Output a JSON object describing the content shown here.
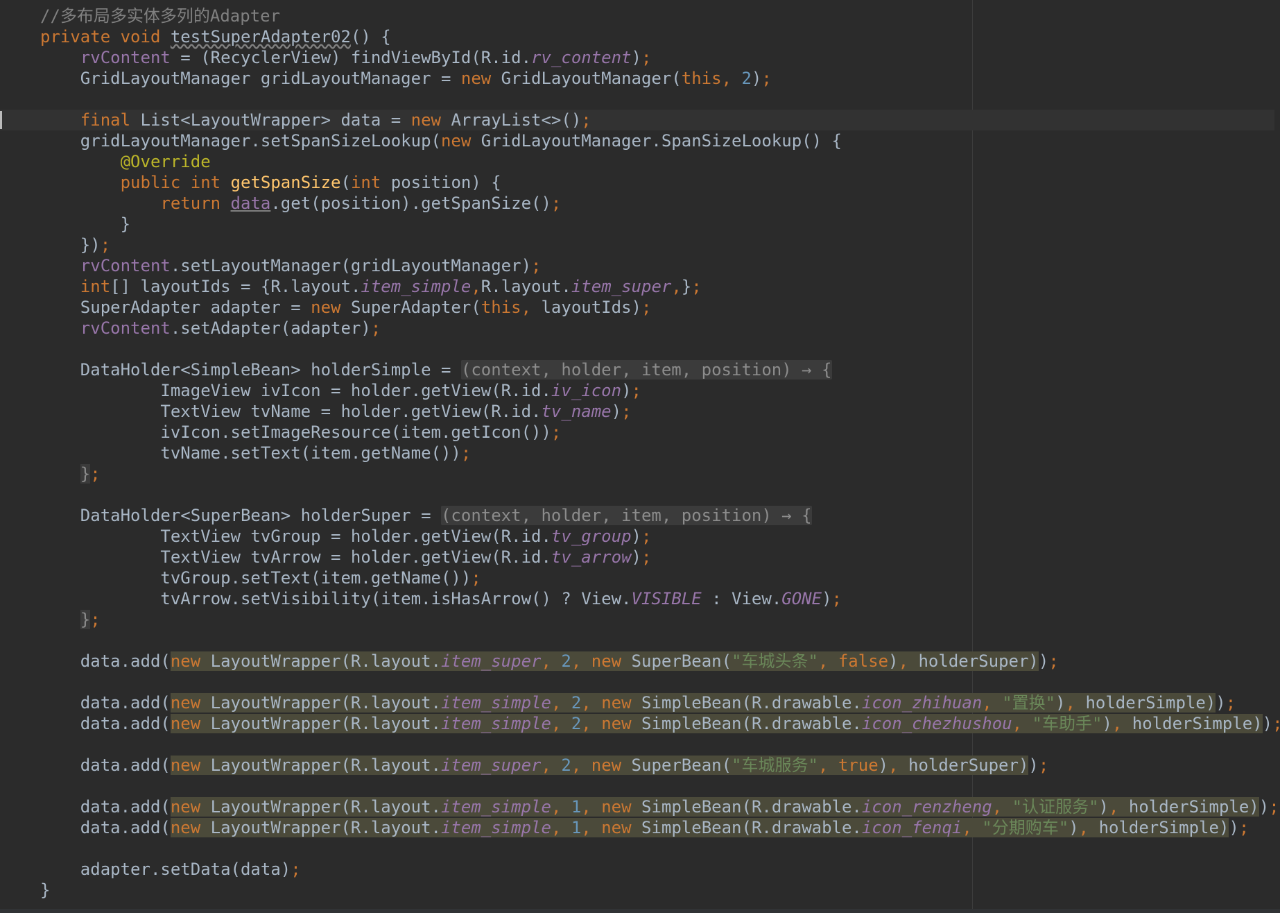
{
  "editor": {
    "language": "java",
    "colors": {
      "background": "#2b2b2b",
      "default": "#a9b7c6",
      "keyword": "#cc7832",
      "comment": "#808080",
      "field": "#9876aa",
      "number": "#6897bb",
      "string": "#6a8759",
      "annotation": "#bbb529",
      "method_decl": "#ffc66d"
    },
    "current_line_index": 5,
    "lines": [
      [
        {
          "t": "//多布局多实体多列的Adapter",
          "c": "cm"
        }
      ],
      [
        {
          "t": "private void ",
          "c": "kw"
        },
        {
          "t": "testSuperAdapter02",
          "c": "wavy"
        },
        {
          "t": "() {",
          "c": ""
        }
      ],
      [
        {
          "t": "    ",
          "c": ""
        },
        {
          "t": "rvContent",
          "c": "fld"
        },
        {
          "t": " = (RecyclerView) findViewById(R.id.",
          "c": ""
        },
        {
          "t": "rv_content",
          "c": "ifld"
        },
        {
          "t": ")",
          "c": ""
        },
        {
          "t": ";",
          "c": "kw"
        }
      ],
      [
        {
          "t": "    GridLayoutManager gridLayoutManager = ",
          "c": ""
        },
        {
          "t": "new ",
          "c": "kw"
        },
        {
          "t": "GridLayoutManager(",
          "c": ""
        },
        {
          "t": "this",
          "c": "kw"
        },
        {
          "t": ", ",
          "c": "kw"
        },
        {
          "t": "2",
          "c": "num"
        },
        {
          "t": ")",
          "c": ""
        },
        {
          "t": ";",
          "c": "kw"
        }
      ],
      [],
      [
        {
          "t": "    ",
          "c": ""
        },
        {
          "t": "final ",
          "c": "kw"
        },
        {
          "t": "List<LayoutWrapper> data = ",
          "c": ""
        },
        {
          "t": "new ",
          "c": "kw"
        },
        {
          "t": "ArrayList<>()",
          "c": ""
        },
        {
          "t": ";",
          "c": "kw"
        }
      ],
      [
        {
          "t": "    gridLayoutManager.setSpanSizeLookup(",
          "c": ""
        },
        {
          "t": "new ",
          "c": "kw"
        },
        {
          "t": "GridLayoutManager.SpanSizeLookup() {",
          "c": ""
        }
      ],
      [
        {
          "t": "        ",
          "c": ""
        },
        {
          "t": "@Override",
          "c": "ann"
        }
      ],
      [
        {
          "t": "        ",
          "c": ""
        },
        {
          "t": "public int ",
          "c": "kw"
        },
        {
          "t": "getSpanSize",
          "c": "mth"
        },
        {
          "t": "(",
          "c": ""
        },
        {
          "t": "int ",
          "c": "kw"
        },
        {
          "t": "position) {",
          "c": ""
        }
      ],
      [
        {
          "t": "            ",
          "c": ""
        },
        {
          "t": "return ",
          "c": "kw"
        },
        {
          "t": "data",
          "c": "fld ul"
        },
        {
          "t": ".get(position).getSpanSize()",
          "c": ""
        },
        {
          "t": ";",
          "c": "kw"
        }
      ],
      [
        {
          "t": "        }",
          "c": ""
        }
      ],
      [
        {
          "t": "    })",
          "c": ""
        },
        {
          "t": ";",
          "c": "kw"
        }
      ],
      [
        {
          "t": "    ",
          "c": ""
        },
        {
          "t": "rvContent",
          "c": "fld"
        },
        {
          "t": ".setLayoutManager(gridLayoutManager)",
          "c": ""
        },
        {
          "t": ";",
          "c": "kw"
        }
      ],
      [
        {
          "t": "    ",
          "c": ""
        },
        {
          "t": "int",
          "c": "kw"
        },
        {
          "t": "[] layoutIds = {R.layout.",
          "c": ""
        },
        {
          "t": "item_simple",
          "c": "ifld"
        },
        {
          "t": ",",
          "c": "kw"
        },
        {
          "t": "R.layout.",
          "c": ""
        },
        {
          "t": "item_super",
          "c": "ifld"
        },
        {
          "t": ",",
          "c": "kw"
        },
        {
          "t": "}",
          "c": ""
        },
        {
          "t": ";",
          "c": "kw"
        }
      ],
      [
        {
          "t": "    SuperAdapter adapter = ",
          "c": ""
        },
        {
          "t": "new ",
          "c": "kw"
        },
        {
          "t": "SuperAdapter(",
          "c": ""
        },
        {
          "t": "this",
          "c": "kw"
        },
        {
          "t": ", ",
          "c": "kw"
        },
        {
          "t": "layoutIds)",
          "c": ""
        },
        {
          "t": ";",
          "c": "kw"
        }
      ],
      [
        {
          "t": "    ",
          "c": ""
        },
        {
          "t": "rvContent",
          "c": "fld"
        },
        {
          "t": ".setAdapter(adapter)",
          "c": ""
        },
        {
          "t": ";",
          "c": "kw"
        }
      ],
      [],
      [
        {
          "t": "    DataHolder<SimpleBean> holderSimple = ",
          "c": ""
        },
        {
          "t": "(context, holder, item, position) → {",
          "c": "fold"
        }
      ],
      [
        {
          "t": "            ImageView ivIcon = holder.getView(R.id.",
          "c": ""
        },
        {
          "t": "iv_icon",
          "c": "ifld"
        },
        {
          "t": ")",
          "c": ""
        },
        {
          "t": ";",
          "c": "kw"
        }
      ],
      [
        {
          "t": "            TextView tvName = holder.getView(R.id.",
          "c": ""
        },
        {
          "t": "tv_name",
          "c": "ifld"
        },
        {
          "t": ")",
          "c": ""
        },
        {
          "t": ";",
          "c": "kw"
        }
      ],
      [
        {
          "t": "            ivIcon.setImageResource(item.getIcon())",
          "c": ""
        },
        {
          "t": ";",
          "c": "kw"
        }
      ],
      [
        {
          "t": "            tvName.setText(item.getName())",
          "c": ""
        },
        {
          "t": ";",
          "c": "kw"
        }
      ],
      [
        {
          "t": "    ",
          "c": ""
        },
        {
          "t": "}",
          "c": "dimbrace"
        },
        {
          "t": ";",
          "c": "kw"
        }
      ],
      [],
      [
        {
          "t": "    DataHolder<SuperBean> holderSuper = ",
          "c": ""
        },
        {
          "t": "(context, holder, item, position) → {",
          "c": "fold"
        }
      ],
      [
        {
          "t": "            TextView tvGroup = holder.getView(R.id.",
          "c": ""
        },
        {
          "t": "tv_group",
          "c": "ifld"
        },
        {
          "t": ")",
          "c": ""
        },
        {
          "t": ";",
          "c": "kw"
        }
      ],
      [
        {
          "t": "            TextView tvArrow = holder.getView(R.id.",
          "c": ""
        },
        {
          "t": "tv_arrow",
          "c": "ifld"
        },
        {
          "t": ")",
          "c": ""
        },
        {
          "t": ";",
          "c": "kw"
        }
      ],
      [
        {
          "t": "            tvGroup.setText(item.getName())",
          "c": ""
        },
        {
          "t": ";",
          "c": "kw"
        }
      ],
      [
        {
          "t": "            tvArrow.setVisibility(item.isHasArrow() ? View.",
          "c": ""
        },
        {
          "t": "VISIBLE",
          "c": "ifld"
        },
        {
          "t": " : View.",
          "c": ""
        },
        {
          "t": "GONE",
          "c": "ifld"
        },
        {
          "t": ")",
          "c": ""
        },
        {
          "t": ";",
          "c": "kw"
        }
      ],
      [
        {
          "t": "    ",
          "c": ""
        },
        {
          "t": "}",
          "c": "dimbrace"
        },
        {
          "t": ";",
          "c": "kw"
        }
      ],
      [],
      [
        {
          "t": "    data.add(",
          "c": ""
        },
        {
          "t": "new ",
          "c": "kw hl"
        },
        {
          "t": "LayoutWrapper(R.layout.",
          "c": "hl"
        },
        {
          "t": "item_super",
          "c": "ifld hl"
        },
        {
          "t": ", ",
          "c": "kw hl"
        },
        {
          "t": "2",
          "c": "num hl"
        },
        {
          "t": ", ",
          "c": "kw hl"
        },
        {
          "t": "new ",
          "c": "kw hl"
        },
        {
          "t": "SuperBean(",
          "c": "hl"
        },
        {
          "t": "\"车城头条\"",
          "c": "str hl"
        },
        {
          "t": ", ",
          "c": "kw hl"
        },
        {
          "t": "false",
          "c": "kw hl"
        },
        {
          "t": ")",
          "c": "hl"
        },
        {
          "t": ", ",
          "c": "kw hl"
        },
        {
          "t": "holderSuper)",
          "c": "hl"
        },
        {
          "t": ")",
          "c": ""
        },
        {
          "t": ";",
          "c": "kw"
        }
      ],
      [],
      [
        {
          "t": "    data.add(",
          "c": ""
        },
        {
          "t": "new ",
          "c": "kw hl"
        },
        {
          "t": "LayoutWrapper(R.layout.",
          "c": "hl"
        },
        {
          "t": "item_simple",
          "c": "ifld hl"
        },
        {
          "t": ", ",
          "c": "kw hl"
        },
        {
          "t": "2",
          "c": "num hl"
        },
        {
          "t": ", ",
          "c": "kw hl"
        },
        {
          "t": "new ",
          "c": "kw hl"
        },
        {
          "t": "SimpleBean(R.drawable.",
          "c": "hl"
        },
        {
          "t": "icon_zhihuan",
          "c": "ifld hl"
        },
        {
          "t": ", ",
          "c": "kw hl"
        },
        {
          "t": "\"置换\"",
          "c": "str hl"
        },
        {
          "t": ")",
          "c": "hl"
        },
        {
          "t": ", ",
          "c": "kw hl"
        },
        {
          "t": "holderSimple)",
          "c": "hl"
        },
        {
          "t": ")",
          "c": ""
        },
        {
          "t": ";",
          "c": "kw"
        }
      ],
      [
        {
          "t": "    data.add(",
          "c": ""
        },
        {
          "t": "new ",
          "c": "kw hl"
        },
        {
          "t": "LayoutWrapper(R.layout.",
          "c": "hl"
        },
        {
          "t": "item_simple",
          "c": "ifld hl"
        },
        {
          "t": ", ",
          "c": "kw hl"
        },
        {
          "t": "2",
          "c": "num hl"
        },
        {
          "t": ", ",
          "c": "kw hl"
        },
        {
          "t": "new ",
          "c": "kw hl"
        },
        {
          "t": "SimpleBean(R.drawable.",
          "c": "hl"
        },
        {
          "t": "icon_chezhushou",
          "c": "ifld hl"
        },
        {
          "t": ", ",
          "c": "kw hl"
        },
        {
          "t": "\"车助手\"",
          "c": "str hl"
        },
        {
          "t": ")",
          "c": "hl"
        },
        {
          "t": ", ",
          "c": "kw hl"
        },
        {
          "t": "holderSimple)",
          "c": "hl"
        },
        {
          "t": ")",
          "c": ""
        },
        {
          "t": ";",
          "c": "kw"
        }
      ],
      [],
      [
        {
          "t": "    data.add(",
          "c": ""
        },
        {
          "t": "new ",
          "c": "kw hl"
        },
        {
          "t": "LayoutWrapper(R.layout.",
          "c": "hl"
        },
        {
          "t": "item_super",
          "c": "ifld hl"
        },
        {
          "t": ", ",
          "c": "kw hl"
        },
        {
          "t": "2",
          "c": "num hl"
        },
        {
          "t": ", ",
          "c": "kw hl"
        },
        {
          "t": "new ",
          "c": "kw hl"
        },
        {
          "t": "SuperBean(",
          "c": "hl"
        },
        {
          "t": "\"车城服务\"",
          "c": "str hl"
        },
        {
          "t": ", ",
          "c": "kw hl"
        },
        {
          "t": "true",
          "c": "kw hl"
        },
        {
          "t": ")",
          "c": "hl"
        },
        {
          "t": ", ",
          "c": "kw hl"
        },
        {
          "t": "holderSuper)",
          "c": "hl"
        },
        {
          "t": ")",
          "c": ""
        },
        {
          "t": ";",
          "c": "kw"
        }
      ],
      [],
      [
        {
          "t": "    data.add(",
          "c": ""
        },
        {
          "t": "new ",
          "c": "kw hl"
        },
        {
          "t": "LayoutWrapper(R.layout.",
          "c": "hl"
        },
        {
          "t": "item_simple",
          "c": "ifld hl"
        },
        {
          "t": ", ",
          "c": "kw hl"
        },
        {
          "t": "1",
          "c": "num hl"
        },
        {
          "t": ", ",
          "c": "kw hl"
        },
        {
          "t": "new ",
          "c": "kw hl"
        },
        {
          "t": "SimpleBean(R.drawable.",
          "c": "hl"
        },
        {
          "t": "icon_renzheng",
          "c": "ifld hl"
        },
        {
          "t": ", ",
          "c": "kw hl"
        },
        {
          "t": "\"认证服务\"",
          "c": "str hl"
        },
        {
          "t": ")",
          "c": "hl"
        },
        {
          "t": ", ",
          "c": "kw hl"
        },
        {
          "t": "holderSimple)",
          "c": "hl"
        },
        {
          "t": ")",
          "c": ""
        },
        {
          "t": ";",
          "c": "kw"
        }
      ],
      [
        {
          "t": "    data.add(",
          "c": ""
        },
        {
          "t": "new ",
          "c": "kw hl"
        },
        {
          "t": "LayoutWrapper(R.layout.",
          "c": "hl"
        },
        {
          "t": "item_simple",
          "c": "ifld hl"
        },
        {
          "t": ", ",
          "c": "kw hl"
        },
        {
          "t": "1",
          "c": "num hl"
        },
        {
          "t": ", ",
          "c": "kw hl"
        },
        {
          "t": "new ",
          "c": "kw hl"
        },
        {
          "t": "SimpleBean(R.drawable.",
          "c": "hl"
        },
        {
          "t": "icon_fenqi",
          "c": "ifld hl"
        },
        {
          "t": ", ",
          "c": "kw hl"
        },
        {
          "t": "\"分期购车\"",
          "c": "str hl"
        },
        {
          "t": ")",
          "c": "hl"
        },
        {
          "t": ", ",
          "c": "kw hl"
        },
        {
          "t": "holderSimple)",
          "c": "hl"
        },
        {
          "t": ")",
          "c": ""
        },
        {
          "t": ";",
          "c": "kw"
        }
      ],
      [],
      [
        {
          "t": "    adapter.setData(data)",
          "c": ""
        },
        {
          "t": ";",
          "c": "kw"
        }
      ],
      [
        {
          "t": "}",
          "c": ""
        }
      ]
    ]
  }
}
